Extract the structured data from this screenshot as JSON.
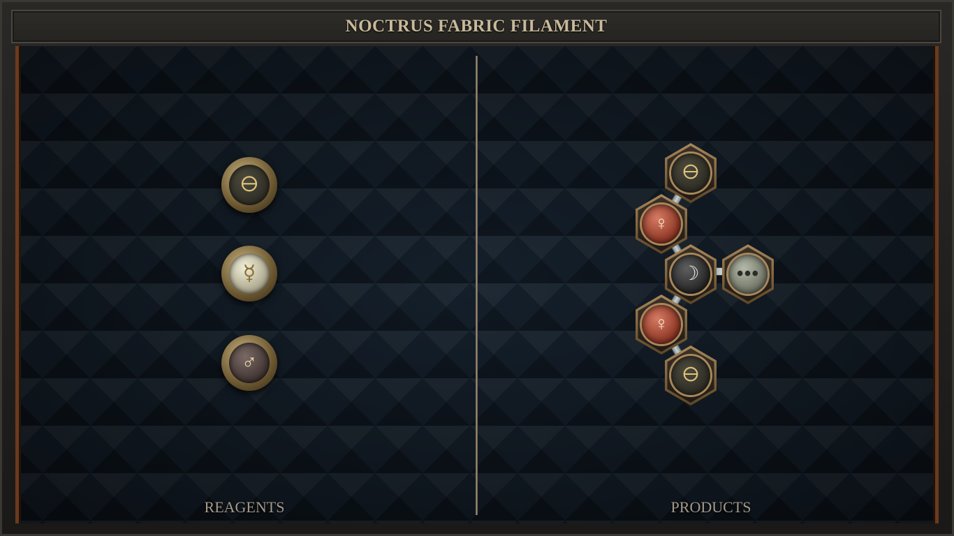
{
  "title": "NOCTRUS FABRIC FILAMENT",
  "panels": {
    "reagents_label": "REAGENTS",
    "products_label": "PRODUCTS"
  },
  "reagents": [
    {
      "name": "salt",
      "glyph": "🜔"
    },
    {
      "name": "quicksilver",
      "glyph": "☿"
    },
    {
      "name": "iron",
      "glyph": "♂"
    }
  ],
  "product_molecule": [
    {
      "name": "salt",
      "glyph": "🜔"
    },
    {
      "name": "copper",
      "glyph": "♀"
    },
    {
      "name": "silver",
      "glyph": "☽"
    },
    {
      "name": "repeat",
      "glyph": "•••"
    },
    {
      "name": "copper",
      "glyph": "♀"
    },
    {
      "name": "salt",
      "glyph": "🜔"
    }
  ],
  "colors": {
    "frame_border": "#6b3a1e",
    "title_text": "#c8b99a",
    "board_bg": "#131c26",
    "label_text": "#a49a8c"
  }
}
